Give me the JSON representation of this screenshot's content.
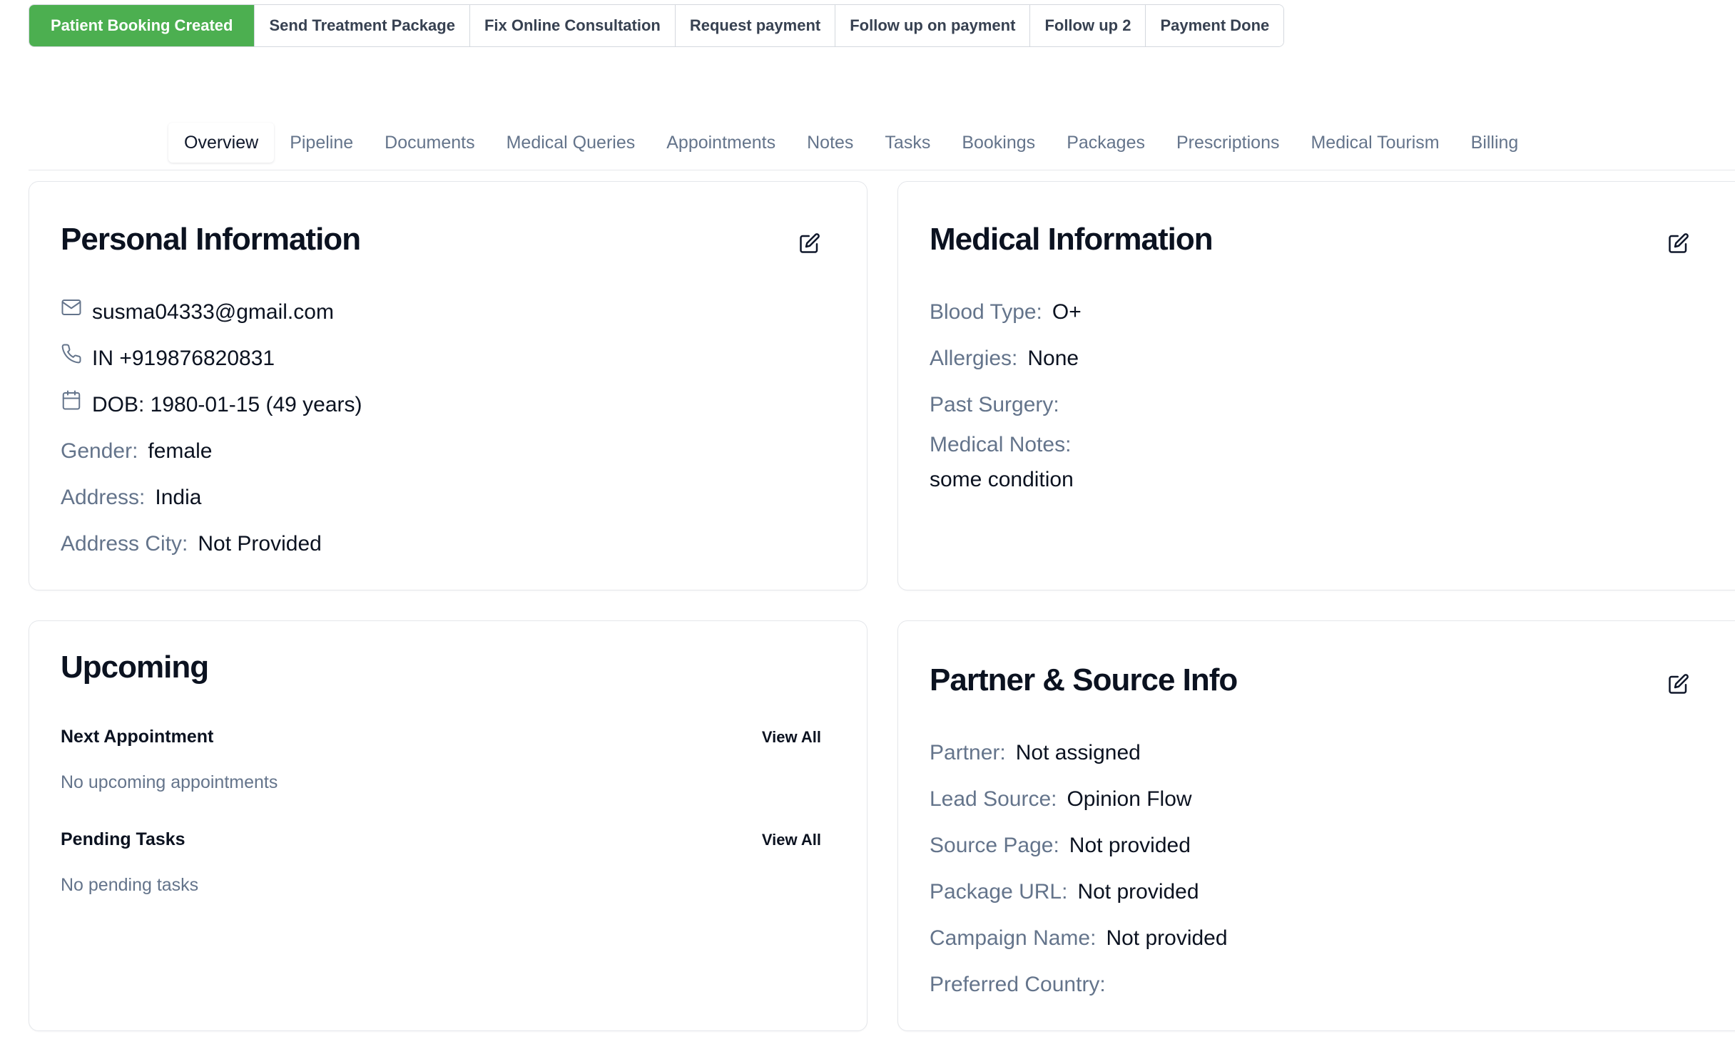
{
  "stages": [
    {
      "label": "Patient Booking Created",
      "active": true
    },
    {
      "label": "Send Treatment Package"
    },
    {
      "label": "Fix Online Consultation"
    },
    {
      "label": "Request payment"
    },
    {
      "label": "Follow up on payment"
    },
    {
      "label": "Follow up 2"
    },
    {
      "label": "Payment Done"
    }
  ],
  "tabs": [
    "Overview",
    "Pipeline",
    "Documents",
    "Medical Queries",
    "Appointments",
    "Notes",
    "Tasks",
    "Bookings",
    "Packages",
    "Prescriptions",
    "Medical Tourism",
    "Billing"
  ],
  "active_tab": "Overview",
  "personal": {
    "title": "Personal Information",
    "email": "susma04333@gmail.com",
    "phone": "IN +919876820831",
    "dob": "DOB: 1980-01-15 (49 years)",
    "gender_label": "Gender:",
    "gender": "female",
    "address_label": "Address:",
    "address": "India",
    "city_label": "Address City:",
    "city": "Not Provided"
  },
  "medical": {
    "title": "Medical Information",
    "blood_label": "Blood Type:",
    "blood": "O+",
    "allergies_label": "Allergies:",
    "allergies": "None",
    "surgery_label": "Past Surgery:",
    "surgery": "",
    "notes_label": "Medical Notes:",
    "notes": "some condition"
  },
  "upcoming": {
    "title": "Upcoming",
    "appt_title": "Next Appointment",
    "appt_view_all": "View All",
    "appt_empty": "No upcoming appointments",
    "tasks_title": "Pending Tasks",
    "tasks_view_all": "View All",
    "tasks_empty": "No pending tasks"
  },
  "partner": {
    "title": "Partner & Source Info",
    "partner_label": "Partner:",
    "partner": "Not assigned",
    "lead_label": "Lead Source:",
    "lead": "Opinion Flow",
    "page_label": "Source Page:",
    "page": "Not provided",
    "package_label": "Package URL:",
    "package": "Not provided",
    "campaign_label": "Campaign Name:",
    "campaign": "Not provided",
    "country_label": "Preferred Country:",
    "country": ""
  },
  "colors": {
    "accent": "#4caf50",
    "muted": "#64748b",
    "border": "#e5e7eb"
  }
}
